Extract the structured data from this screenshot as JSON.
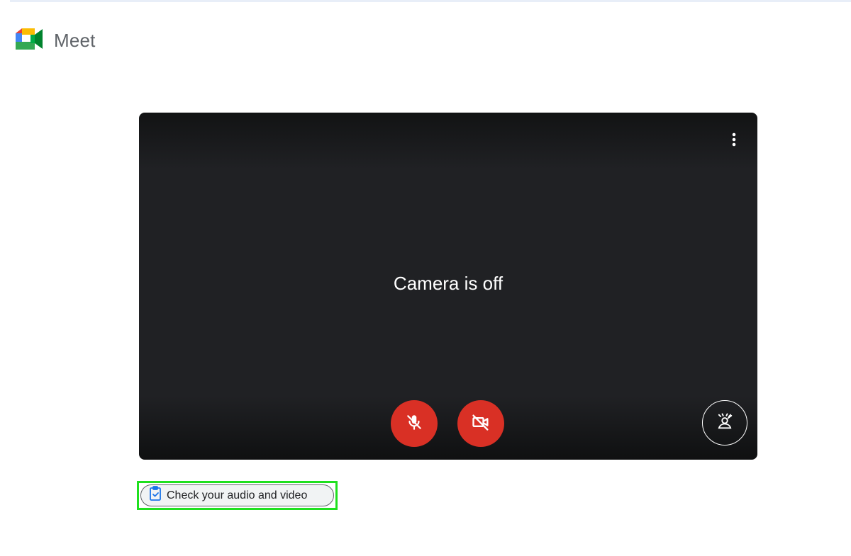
{
  "app": {
    "name": "Meet"
  },
  "preview": {
    "camera_status": "Camera is off"
  },
  "controls": {
    "mic": "mic-off-icon",
    "camera": "camera-off-icon",
    "effects": "visual-effects-icon",
    "more": "more-options-icon"
  },
  "check_button": {
    "label": "Check your audio and video",
    "icon": "clipboard-check-icon"
  },
  "colors": {
    "off_red": "#d93025",
    "highlight_green": "#1fe01f",
    "preview_bg": "#202124"
  }
}
